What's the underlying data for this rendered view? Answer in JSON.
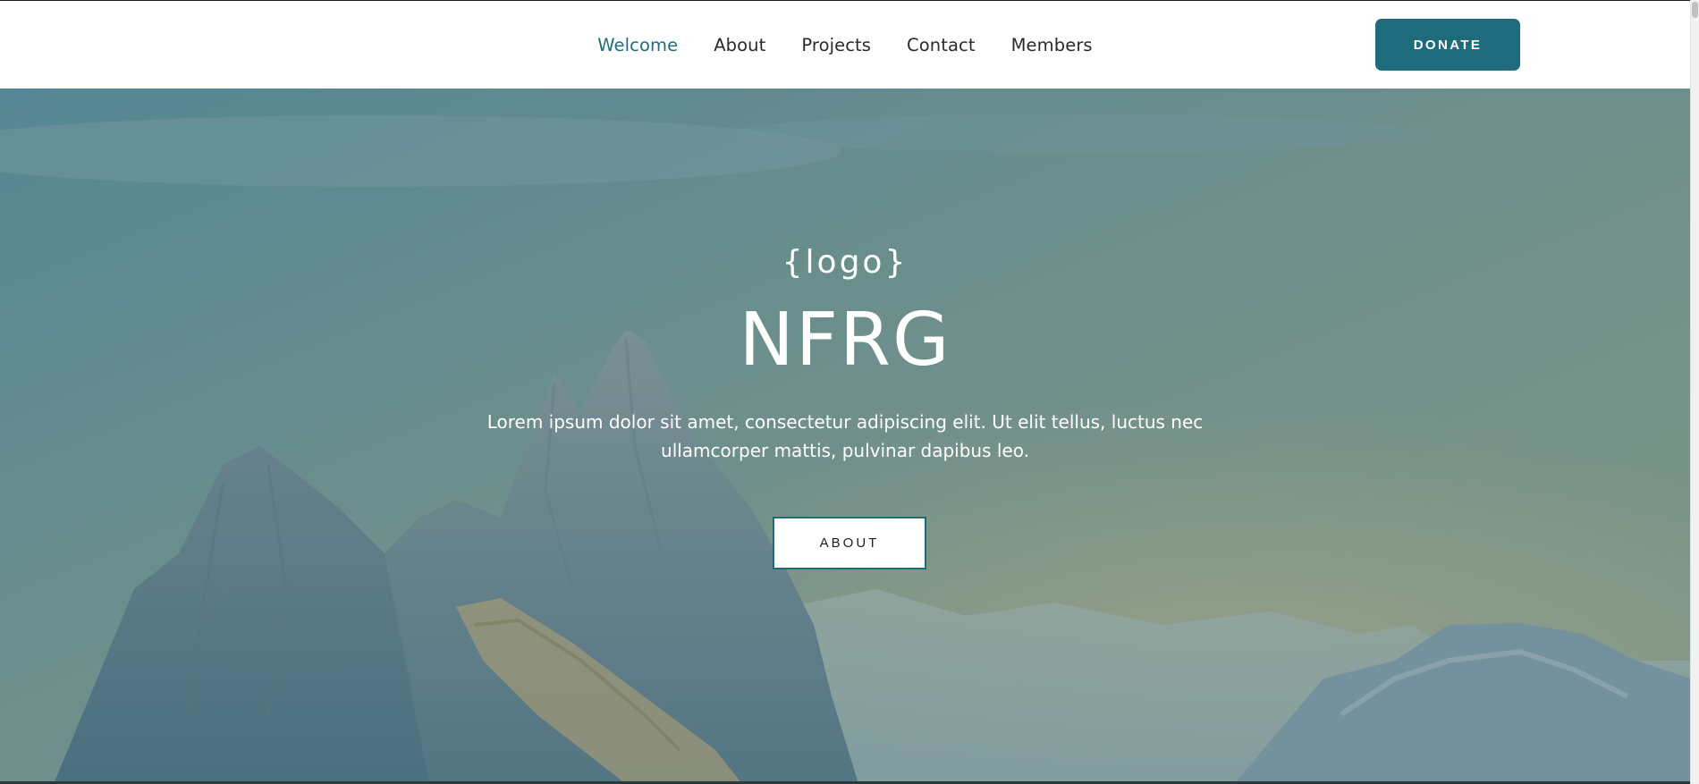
{
  "nav": {
    "items": [
      {
        "label": "Welcome",
        "active": true
      },
      {
        "label": "About",
        "active": false
      },
      {
        "label": "Projects",
        "active": false
      },
      {
        "label": "Contact",
        "active": false
      },
      {
        "label": "Members",
        "active": false
      }
    ],
    "donate_label": "DONATE"
  },
  "hero": {
    "logo": "{logo}",
    "title": "NFRG",
    "description": "Lorem ipsum dolor sit amet, consectetur adipiscing elit. Ut elit tellus, luctus nec ullamcorper mattis, pulvinar dapibus leo.",
    "button_label": "ABOUT"
  },
  "colors": {
    "accent": "#1e6b7b",
    "nav_text": "#2a2a2a",
    "nav_active": "#1e6d7d"
  }
}
